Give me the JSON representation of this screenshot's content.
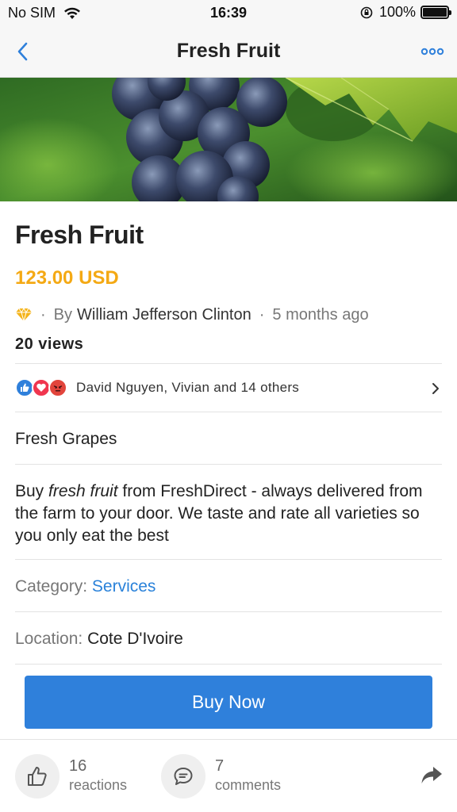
{
  "status_bar": {
    "carrier": "No SIM",
    "time": "16:39",
    "battery": "100%",
    "battery_level": 1.0
  },
  "nav": {
    "title": "Fresh Fruit",
    "back_icon": "chevron-left-icon",
    "more_icon": "ellipsis-icon"
  },
  "product": {
    "title": "Fresh Fruit",
    "price": "123.00 USD",
    "by_label": "By",
    "author": "William Jefferson Clinton",
    "time_ago": "5 months ago",
    "views": "20 views",
    "separator": "·"
  },
  "reactions": {
    "summary": "David Nguyen, Vivian and 14 others",
    "icons": [
      "like-icon",
      "love-icon",
      "angry-icon"
    ]
  },
  "details": {
    "subtitle": "Fresh Grapes",
    "description_pre": "Buy ",
    "description_em": "fresh fruit",
    "description_post": " from FreshDirect - always delivered from the farm to your door. We taste and rate all varieties so you only eat the best",
    "category_label": "Category: ",
    "category_value": "Services",
    "location_label": "Location: ",
    "location_value": "Cote D'Ivoire"
  },
  "buy_button": "Buy Now",
  "footer": {
    "reactions_count": "16",
    "reactions_label": "reactions",
    "comments_count": "7",
    "comments_label": "comments"
  },
  "colors": {
    "accent": "#2f80db",
    "price": "#f4a914",
    "link": "#2a82da"
  }
}
